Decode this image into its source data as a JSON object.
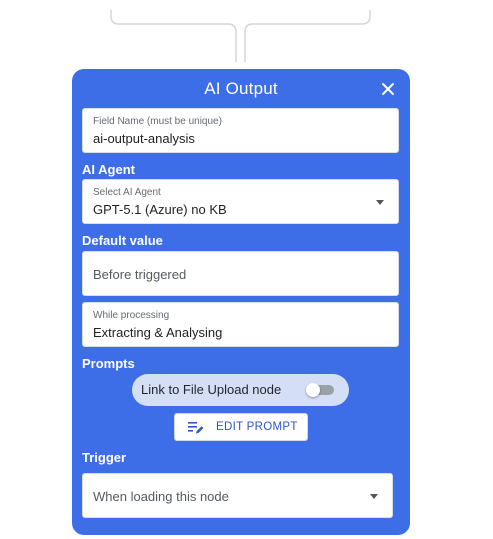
{
  "panel": {
    "title": "AI Output",
    "accent_color": "#3d6ee8"
  },
  "field_name": {
    "label": "Field Name (must be unique)",
    "value": "ai-output-analysis"
  },
  "ai_agent": {
    "section_label": "AI Agent",
    "select_label": "Select AI Agent",
    "selected_value": "GPT-5.1 (Azure) no KB"
  },
  "default_value": {
    "section_label": "Default value",
    "before_triggered_placeholder": "Before triggered",
    "while_processing_label": "While processing",
    "while_processing_value": "Extracting & Analysing"
  },
  "prompts": {
    "section_label": "Prompts",
    "toggle_label": "Link to File Upload node",
    "toggle_on": false,
    "edit_button_label": "EDIT PROMPT"
  },
  "trigger": {
    "section_label": "Trigger",
    "selected_value": "When loading this node"
  },
  "icons": {
    "close": "close-icon",
    "caret": "chevron-down-icon",
    "edit": "edit-note-icon"
  }
}
